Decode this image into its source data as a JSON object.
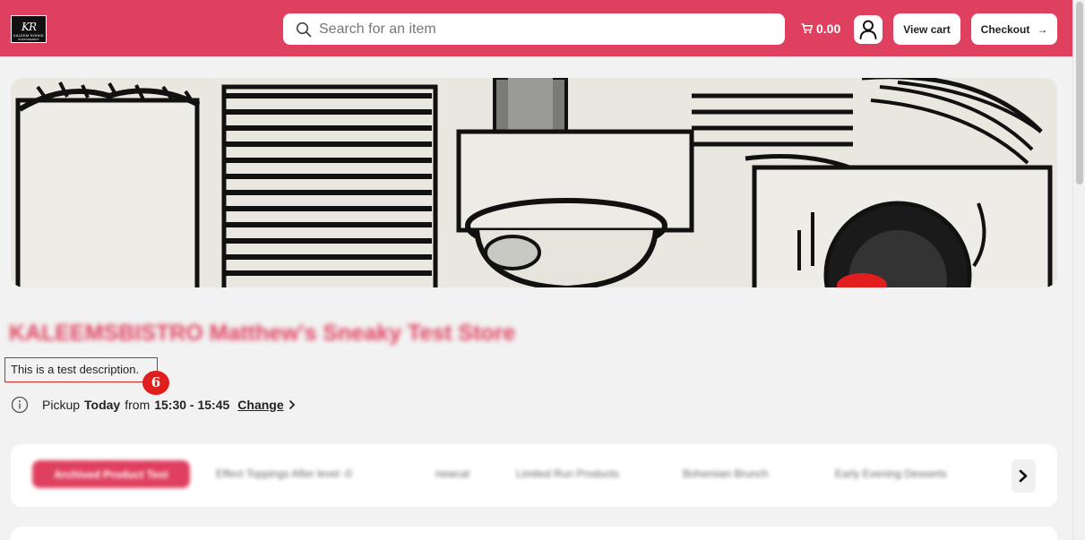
{
  "header": {
    "logo": {
      "monogram": "KR",
      "line1": "KALEEM ROHKE",
      "line2": "PHOTOGRAPHY"
    },
    "search": {
      "placeholder": "Search for an item"
    },
    "cart_total": "0.00",
    "view_cart_label": "View cart",
    "checkout_label": "Checkout",
    "checkout_arrow": "→"
  },
  "store": {
    "title": "KALEEMSBISTRO Matthew's Sneaky Test Store",
    "description": "This is a test description."
  },
  "annotation_badge": "6",
  "pickup": {
    "label": "Pickup",
    "day": "Today",
    "from_label": "from",
    "time_range": "15:30 - 15:45",
    "change_label": "Change"
  },
  "categories": {
    "active": "Archived Product Test",
    "items": [
      "Effect Toppings After level -0",
      "newcat",
      "Limited Run Products",
      "Bohemian Brunch",
      "Early Evening Desserts"
    ]
  },
  "colors": {
    "brand": "#e0405f",
    "annotation": "#e01e1e"
  }
}
